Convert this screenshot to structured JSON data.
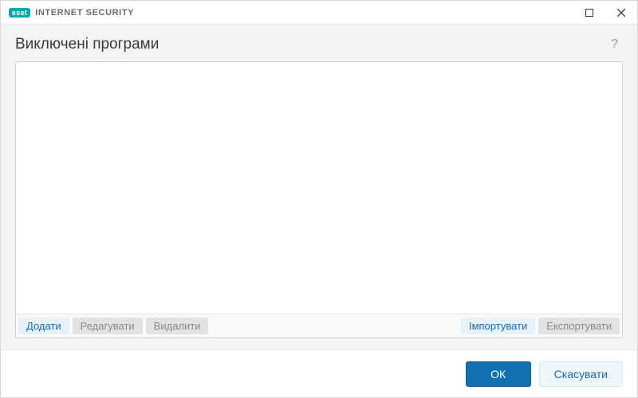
{
  "titlebar": {
    "brand_badge": "eset",
    "brand_text": "INTERNET SECURITY"
  },
  "header": {
    "title": "Виключені програми"
  },
  "toolbar": {
    "add": "Додати",
    "edit": "Редагувати",
    "delete": "Видалити",
    "import": "Імпортувати",
    "export": "Експортувати"
  },
  "list": {
    "items": []
  },
  "footer": {
    "ok": "ОК",
    "cancel": "Скасувати"
  }
}
